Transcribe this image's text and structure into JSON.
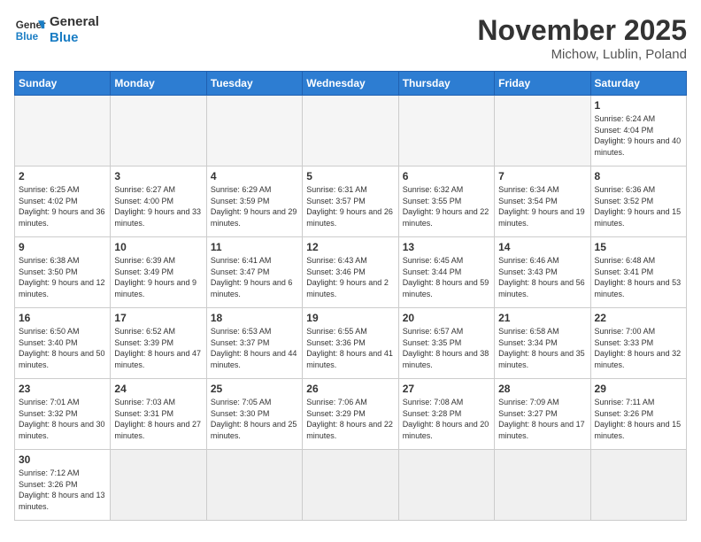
{
  "header": {
    "logo_general": "General",
    "logo_blue": "Blue",
    "title": "November 2025",
    "subtitle": "Michow, Lublin, Poland"
  },
  "weekdays": [
    "Sunday",
    "Monday",
    "Tuesday",
    "Wednesday",
    "Thursday",
    "Friday",
    "Saturday"
  ],
  "weeks": [
    [
      {
        "day": "",
        "info": ""
      },
      {
        "day": "",
        "info": ""
      },
      {
        "day": "",
        "info": ""
      },
      {
        "day": "",
        "info": ""
      },
      {
        "day": "",
        "info": ""
      },
      {
        "day": "",
        "info": ""
      },
      {
        "day": "1",
        "info": "Sunrise: 6:24 AM\nSunset: 4:04 PM\nDaylight: 9 hours and 40 minutes."
      }
    ],
    [
      {
        "day": "2",
        "info": "Sunrise: 6:25 AM\nSunset: 4:02 PM\nDaylight: 9 hours and 36 minutes."
      },
      {
        "day": "3",
        "info": "Sunrise: 6:27 AM\nSunset: 4:00 PM\nDaylight: 9 hours and 33 minutes."
      },
      {
        "day": "4",
        "info": "Sunrise: 6:29 AM\nSunset: 3:59 PM\nDaylight: 9 hours and 29 minutes."
      },
      {
        "day": "5",
        "info": "Sunrise: 6:31 AM\nSunset: 3:57 PM\nDaylight: 9 hours and 26 minutes."
      },
      {
        "day": "6",
        "info": "Sunrise: 6:32 AM\nSunset: 3:55 PM\nDaylight: 9 hours and 22 minutes."
      },
      {
        "day": "7",
        "info": "Sunrise: 6:34 AM\nSunset: 3:54 PM\nDaylight: 9 hours and 19 minutes."
      },
      {
        "day": "8",
        "info": "Sunrise: 6:36 AM\nSunset: 3:52 PM\nDaylight: 9 hours and 15 minutes."
      }
    ],
    [
      {
        "day": "9",
        "info": "Sunrise: 6:38 AM\nSunset: 3:50 PM\nDaylight: 9 hours and 12 minutes."
      },
      {
        "day": "10",
        "info": "Sunrise: 6:39 AM\nSunset: 3:49 PM\nDaylight: 9 hours and 9 minutes."
      },
      {
        "day": "11",
        "info": "Sunrise: 6:41 AM\nSunset: 3:47 PM\nDaylight: 9 hours and 6 minutes."
      },
      {
        "day": "12",
        "info": "Sunrise: 6:43 AM\nSunset: 3:46 PM\nDaylight: 9 hours and 2 minutes."
      },
      {
        "day": "13",
        "info": "Sunrise: 6:45 AM\nSunset: 3:44 PM\nDaylight: 8 hours and 59 minutes."
      },
      {
        "day": "14",
        "info": "Sunrise: 6:46 AM\nSunset: 3:43 PM\nDaylight: 8 hours and 56 minutes."
      },
      {
        "day": "15",
        "info": "Sunrise: 6:48 AM\nSunset: 3:41 PM\nDaylight: 8 hours and 53 minutes."
      }
    ],
    [
      {
        "day": "16",
        "info": "Sunrise: 6:50 AM\nSunset: 3:40 PM\nDaylight: 8 hours and 50 minutes."
      },
      {
        "day": "17",
        "info": "Sunrise: 6:52 AM\nSunset: 3:39 PM\nDaylight: 8 hours and 47 minutes."
      },
      {
        "day": "18",
        "info": "Sunrise: 6:53 AM\nSunset: 3:37 PM\nDaylight: 8 hours and 44 minutes."
      },
      {
        "day": "19",
        "info": "Sunrise: 6:55 AM\nSunset: 3:36 PM\nDaylight: 8 hours and 41 minutes."
      },
      {
        "day": "20",
        "info": "Sunrise: 6:57 AM\nSunset: 3:35 PM\nDaylight: 8 hours and 38 minutes."
      },
      {
        "day": "21",
        "info": "Sunrise: 6:58 AM\nSunset: 3:34 PM\nDaylight: 8 hours and 35 minutes."
      },
      {
        "day": "22",
        "info": "Sunrise: 7:00 AM\nSunset: 3:33 PM\nDaylight: 8 hours and 32 minutes."
      }
    ],
    [
      {
        "day": "23",
        "info": "Sunrise: 7:01 AM\nSunset: 3:32 PM\nDaylight: 8 hours and 30 minutes."
      },
      {
        "day": "24",
        "info": "Sunrise: 7:03 AM\nSunset: 3:31 PM\nDaylight: 8 hours and 27 minutes."
      },
      {
        "day": "25",
        "info": "Sunrise: 7:05 AM\nSunset: 3:30 PM\nDaylight: 8 hours and 25 minutes."
      },
      {
        "day": "26",
        "info": "Sunrise: 7:06 AM\nSunset: 3:29 PM\nDaylight: 8 hours and 22 minutes."
      },
      {
        "day": "27",
        "info": "Sunrise: 7:08 AM\nSunset: 3:28 PM\nDaylight: 8 hours and 20 minutes."
      },
      {
        "day": "28",
        "info": "Sunrise: 7:09 AM\nSunset: 3:27 PM\nDaylight: 8 hours and 17 minutes."
      },
      {
        "day": "29",
        "info": "Sunrise: 7:11 AM\nSunset: 3:26 PM\nDaylight: 8 hours and 15 minutes."
      }
    ],
    [
      {
        "day": "30",
        "info": "Sunrise: 7:12 AM\nSunset: 3:26 PM\nDaylight: 8 hours and 13 minutes."
      },
      {
        "day": "",
        "info": ""
      },
      {
        "day": "",
        "info": ""
      },
      {
        "day": "",
        "info": ""
      },
      {
        "day": "",
        "info": ""
      },
      {
        "day": "",
        "info": ""
      },
      {
        "day": "",
        "info": ""
      }
    ]
  ]
}
